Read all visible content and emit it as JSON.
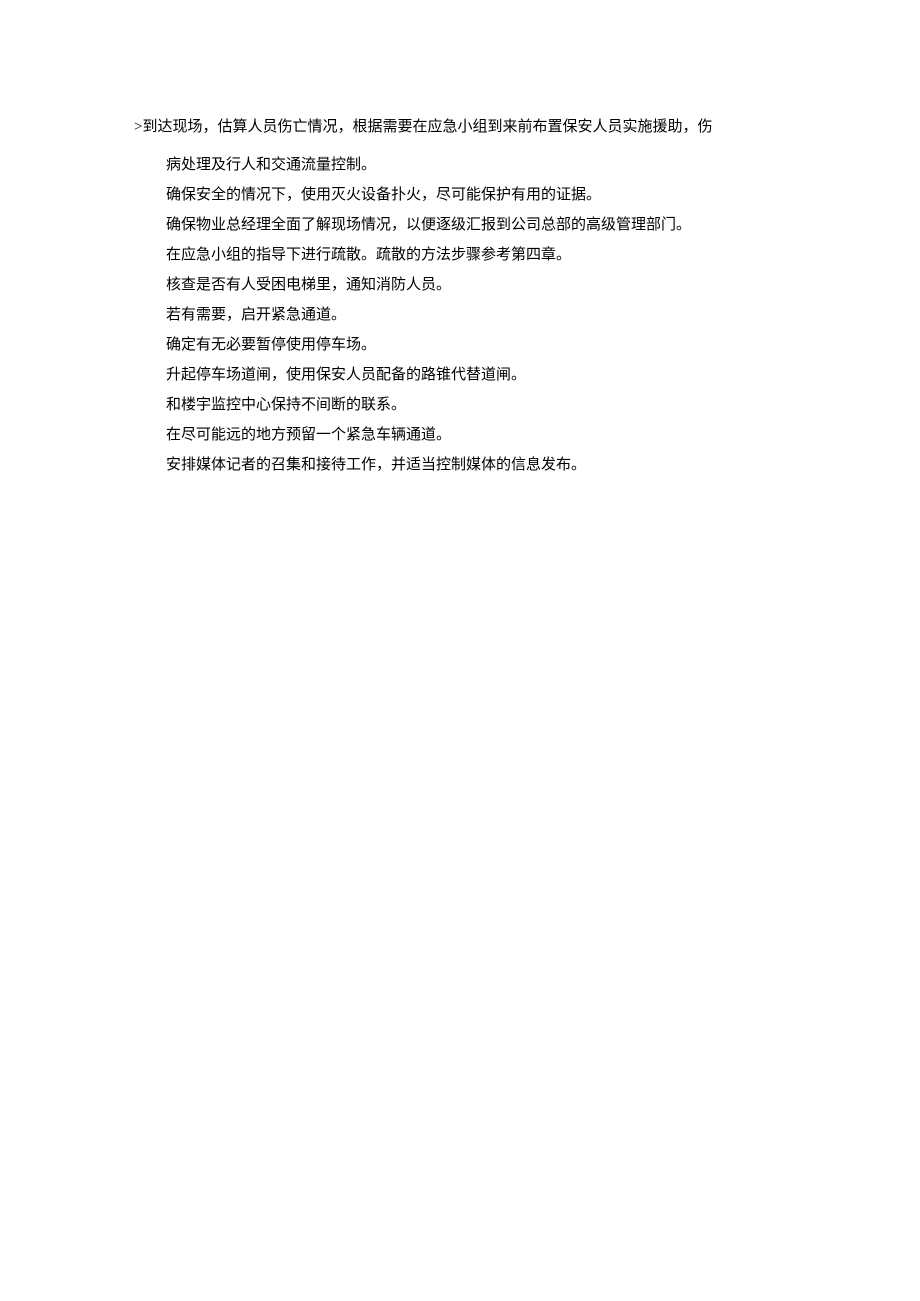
{
  "lead": ">到达现场，估算人员伤亡情况，根据需要在应急小组到来前布置保安人员实施援助，伤",
  "items": [
    "病处理及行人和交通流量控制。",
    "确保安全的情况下，使用灭火设备扑火，尽可能保护有用的证据。",
    "确保物业总经理全面了解现场情况，以便逐级汇报到公司总部的高级管理部门。",
    "在应急小组的指导下进行疏散。疏散的方法步骤参考第四章。",
    "核查是否有人受困电梯里，通知消防人员。",
    "若有需要，启开紧急通道。",
    "确定有无必要暂停使用停车场。",
    "升起停车场道闸，使用保安人员配备的路锥代替道闸。",
    "和楼宇监控中心保持不间断的联系。",
    "在尽可能远的地方预留一个紧急车辆通道。",
    "安排媒体记者的召集和接待工作，并适当控制媒体的信息发布。"
  ]
}
